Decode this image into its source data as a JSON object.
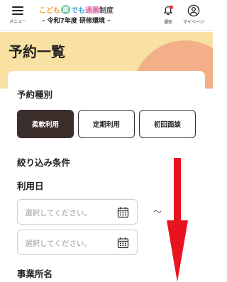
{
  "header": {
    "menu_label": "メニュー",
    "logo": {
      "part1": "こども",
      "part2": "誰",
      "part3": "でも",
      "part4": "通園",
      "part5": "制度"
    },
    "env_title": "– 令和7年度 研修環境 –",
    "notice_label": "通知",
    "mypage_label": "マイページ"
  },
  "page": {
    "title": "予約一覧"
  },
  "reservation_type": {
    "label": "予約種別",
    "options": [
      "柔軟利用",
      "定期利用",
      "初回面談"
    ],
    "selected": "柔軟利用"
  },
  "filter": {
    "label": "絞り込み条件",
    "date_label": "利用日",
    "date_from_placeholder": "選択してください。",
    "date_to_placeholder": "選択してください。",
    "range_separator": "～",
    "office_label": "事業所名"
  },
  "colors": {
    "hero_bg": "#f8e1a2",
    "hero_accent": "#f3b088",
    "active_button": "#3b2e2a",
    "notification_dot": "#e53935",
    "annotation_arrow": "#e8131f"
  }
}
